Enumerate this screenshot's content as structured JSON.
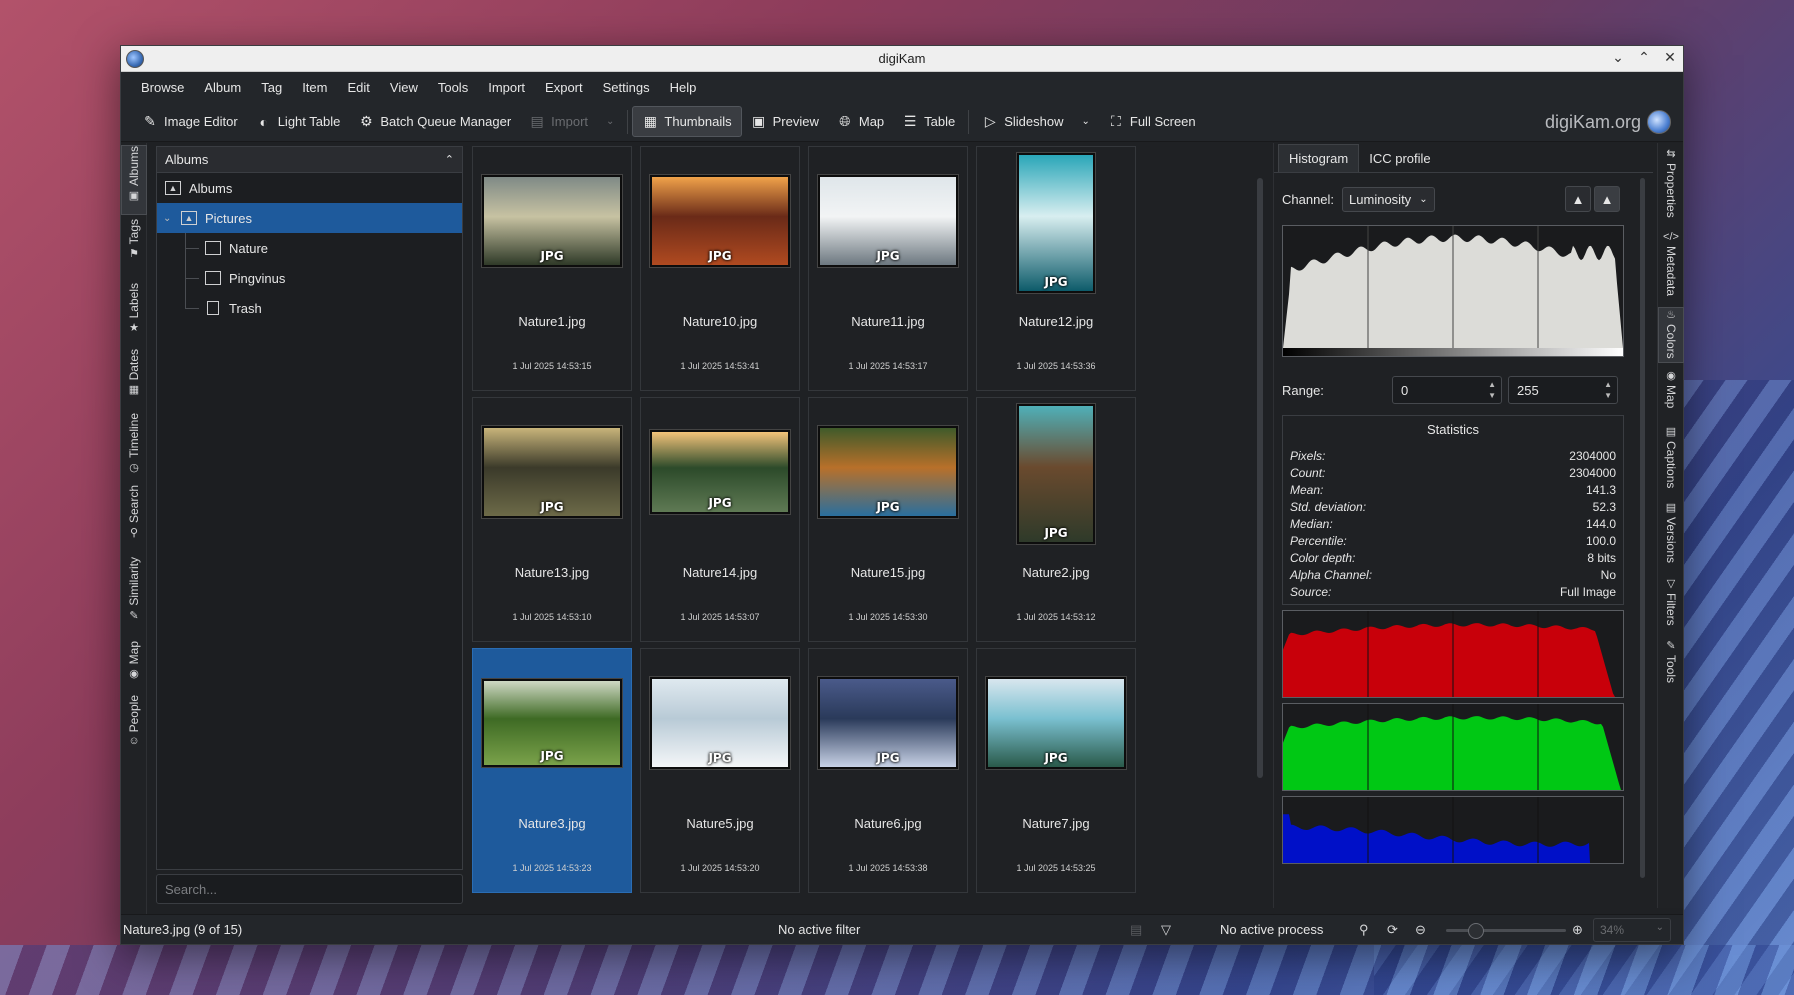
{
  "window": {
    "title": "digiKam"
  },
  "menu": [
    "Browse",
    "Album",
    "Tag",
    "Item",
    "Edit",
    "View",
    "Tools",
    "Import",
    "Export",
    "Settings",
    "Help"
  ],
  "toolbar": {
    "image_editor": "Image Editor",
    "light_table": "Light Table",
    "batch_queue": "Batch Queue Manager",
    "import": "Import",
    "thumbnails": "Thumbnails",
    "preview": "Preview",
    "map": "Map",
    "table": "Table",
    "slideshow": "Slideshow",
    "fullscreen": "Full Screen",
    "brand": "digiKam.org"
  },
  "left_tabs": [
    "Albums",
    "Tags",
    "Labels",
    "Dates",
    "Timeline",
    "Search",
    "Similarity",
    "Map",
    "People"
  ],
  "albums_panel": {
    "header": "Albums",
    "tree": {
      "root": "Albums",
      "pictures": "Pictures",
      "nature": "Nature",
      "pingvinus": "Pingvinus",
      "trash": "Trash"
    },
    "search_placeholder": "Search..."
  },
  "thumbnails": [
    {
      "name": "Nature1.jpg",
      "date": "1 Jul 2025 14:53:15",
      "badge": "JPG",
      "colors": [
        "#7f8a86",
        "#2f3a28",
        "#c7c2a2"
      ]
    },
    {
      "name": "Nature10.jpg",
      "date": "1 Jul 2025 14:53:41",
      "badge": "JPG",
      "colors": [
        "#f0a24a",
        "#b04a20",
        "#6a2a18"
      ]
    },
    {
      "name": "Nature11.jpg",
      "date": "1 Jul 2025 14:53:17",
      "badge": "JPG",
      "colors": [
        "#dfe6ea",
        "#6d7880",
        "#f2f4f5"
      ]
    },
    {
      "name": "Nature12.jpg",
      "date": "1 Jul 2025 14:53:36",
      "badge": "JPG",
      "colors": [
        "#2aa6b8",
        "#0d5b6a",
        "#d8eef0"
      ]
    },
    {
      "name": "Nature13.jpg",
      "date": "1 Jul 2025 14:53:10",
      "badge": "JPG",
      "colors": [
        "#c8b47a",
        "#6d6a48",
        "#3b3a2a"
      ]
    },
    {
      "name": "Nature14.jpg",
      "date": "1 Jul 2025 14:53:07",
      "badge": "JPG",
      "colors": [
        "#f3c37a",
        "#5f7a54",
        "#2c4a2a"
      ]
    },
    {
      "name": "Nature15.jpg",
      "date": "1 Jul 2025 14:53:30",
      "badge": "JPG",
      "colors": [
        "#3f5a2a",
        "#2a6f9e",
        "#b8702a"
      ]
    },
    {
      "name": "Nature2.jpg",
      "date": "1 Jul 2025 14:53:12",
      "badge": "JPG",
      "colors": [
        "#4fb0b8",
        "#2e3a2a",
        "#6a4a2e"
      ]
    },
    {
      "name": "Nature3.jpg",
      "date": "1 Jul 2025 14:53:23",
      "badge": "JPG",
      "colors": [
        "#cfd8c4",
        "#7aa24a",
        "#3e6a24"
      ]
    },
    {
      "name": "Nature5.jpg",
      "date": "1 Jul 2025 14:53:20",
      "badge": "JPG",
      "colors": [
        "#dfe9ef",
        "#f4f6f8",
        "#b8cad6"
      ]
    },
    {
      "name": "Nature6.jpg",
      "date": "1 Jul 2025 14:53:38",
      "badge": "JPG",
      "colors": [
        "#4a5a8a",
        "#c8d2e6",
        "#2a3a5a"
      ]
    },
    {
      "name": "Nature7.jpg",
      "date": "1 Jul 2025 14:53:25",
      "badge": "JPG",
      "colors": [
        "#d8e6ee",
        "#2a5a4a",
        "#7ac0d0"
      ]
    }
  ],
  "right_panel": {
    "tabs": [
      "Histogram",
      "ICC profile"
    ],
    "channel_label": "Channel:",
    "channel_value": "Luminosity",
    "range_label": "Range:",
    "range_min": "0",
    "range_max": "255",
    "stats_title": "Statistics",
    "stats": [
      {
        "k": "Pixels:",
        "v": "2304000"
      },
      {
        "k": "Count:",
        "v": "2304000"
      },
      {
        "k": "Mean:",
        "v": "141.3"
      },
      {
        "k": "Std. deviation:",
        "v": "52.3"
      },
      {
        "k": "Median:",
        "v": "144.0"
      },
      {
        "k": "Percentile:",
        "v": "100.0"
      },
      {
        "k": "Color depth:",
        "v": "8 bits"
      },
      {
        "k": "Alpha Channel:",
        "v": "No"
      },
      {
        "k": "Source:",
        "v": "Full Image"
      }
    ],
    "histogram_colors": {
      "luminosity": "#dcdcd8",
      "red": "#c8000a",
      "green": "#00c814",
      "blue": "#0010c8"
    }
  },
  "right_tabs": [
    "Properties",
    "Metadata",
    "Colors",
    "Map",
    "Captions",
    "Versions",
    "Filters",
    "Tools"
  ],
  "status": {
    "selection": "Nature3.jpg (9 of 15)",
    "filter": "No active filter",
    "process": "No active process",
    "zoom": "34%",
    "zoom_level": 0.25
  }
}
